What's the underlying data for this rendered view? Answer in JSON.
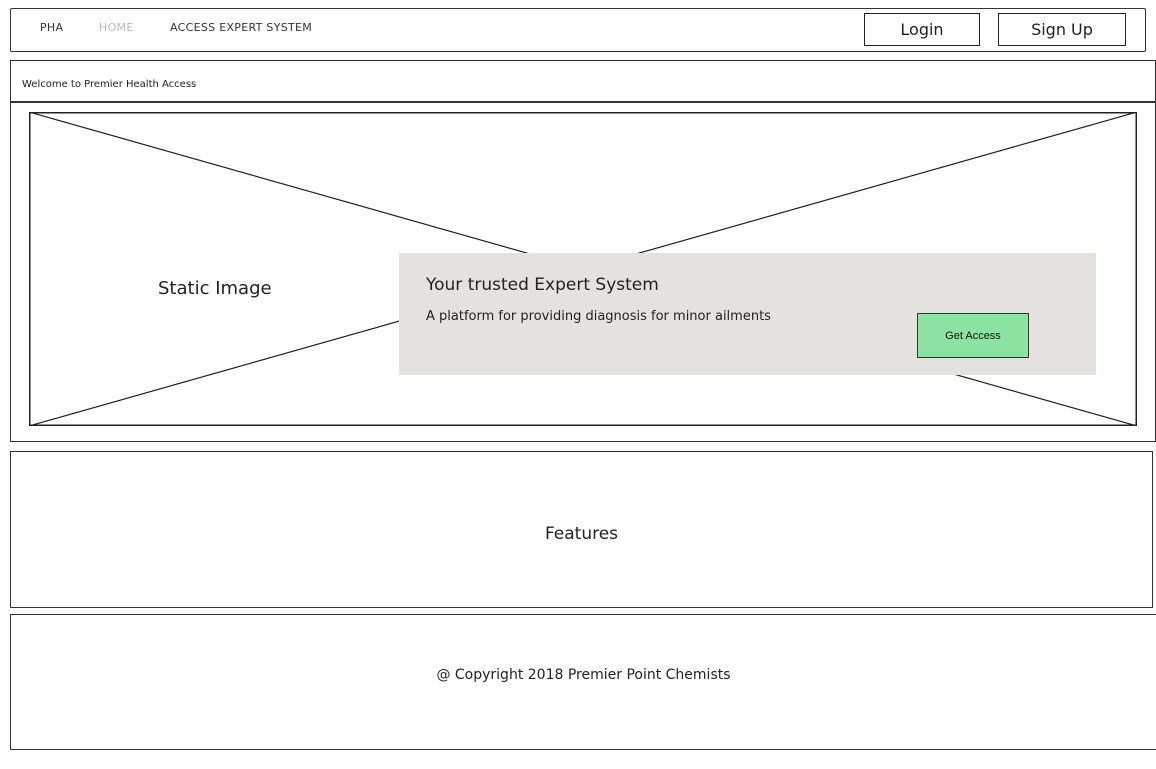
{
  "nav": {
    "brand": "PHA",
    "home": "HOME",
    "access_expert_system": "ACCESS EXPERT SYSTEM",
    "login_label": "Login",
    "signup_label": "Sign Up"
  },
  "welcome": {
    "text": "Welcome to Premier Health Access"
  },
  "hero": {
    "image_label": "Static Image",
    "title": "Your trusted Expert System",
    "subtitle": "A platform for providing diagnosis for minor ailments",
    "cta_label": "Get Access"
  },
  "features": {
    "label": "Features"
  },
  "footer": {
    "copyright": "@ Copyright 2018 Premier Point Chemists"
  },
  "colors": {
    "callout_background": "#e3e2df",
    "cta_background": "#8ae3a0",
    "active_nav": "#b8b8b8"
  }
}
